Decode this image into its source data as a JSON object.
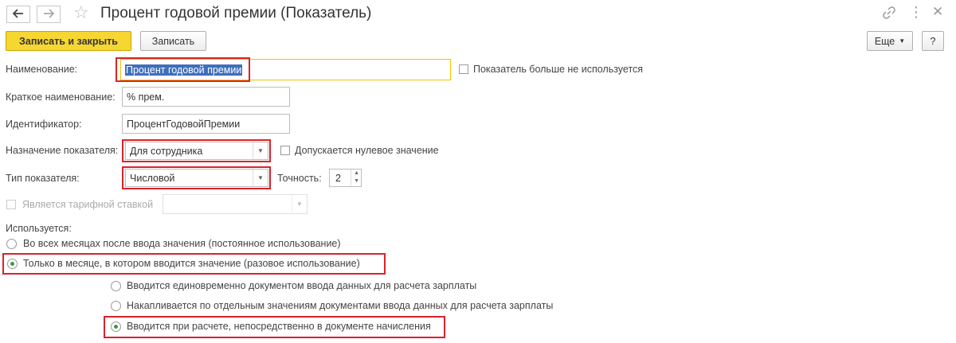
{
  "window": {
    "title": "Процент годовой премии (Показатель)",
    "back_icon": "arrow-left-icon",
    "forward_icon": "arrow-right-icon"
  },
  "toolbar": {
    "save_close_label": "Записать и закрыть",
    "save_label": "Записать",
    "more_label": "Еще",
    "help_label": "?"
  },
  "form": {
    "name_label": "Наименование:",
    "name_value": "Процент годовой премии",
    "unused_checkbox_label": "Показатель больше не используется",
    "short_name_label": "Краткое наименование:",
    "short_name_value": "% прем.",
    "id_label": "Идентификатор:",
    "id_value": "ПроцентГодовойПремии",
    "purpose_label": "Назначение показателя:",
    "purpose_value": "Для сотрудника",
    "zero_allowed_label": "Допускается нулевое значение",
    "type_label": "Тип показателя:",
    "type_value": "Числовой",
    "precision_label": "Точность:",
    "precision_value": "2",
    "tariff_label": "Является тарифной ставкой",
    "usage_label": "Используется:",
    "usage_options": [
      "Во всех месяцах после ввода значения (постоянное использование)",
      "Только в месяце, в котором вводится значение (разовое использование)"
    ],
    "input_options": [
      "Вводится единовременно документом ввода данных для расчета зарплаты",
      "Накапливается по отдельным значениям документами ввода данных для расчета зарплаты",
      "Вводится при расчете, непосредственно в документе начисления"
    ]
  },
  "colors": {
    "highlight": "#d9232a",
    "primary_button": "#f6d630",
    "selection": "#3f6fbd",
    "radio_on": "#3c9a3c"
  }
}
